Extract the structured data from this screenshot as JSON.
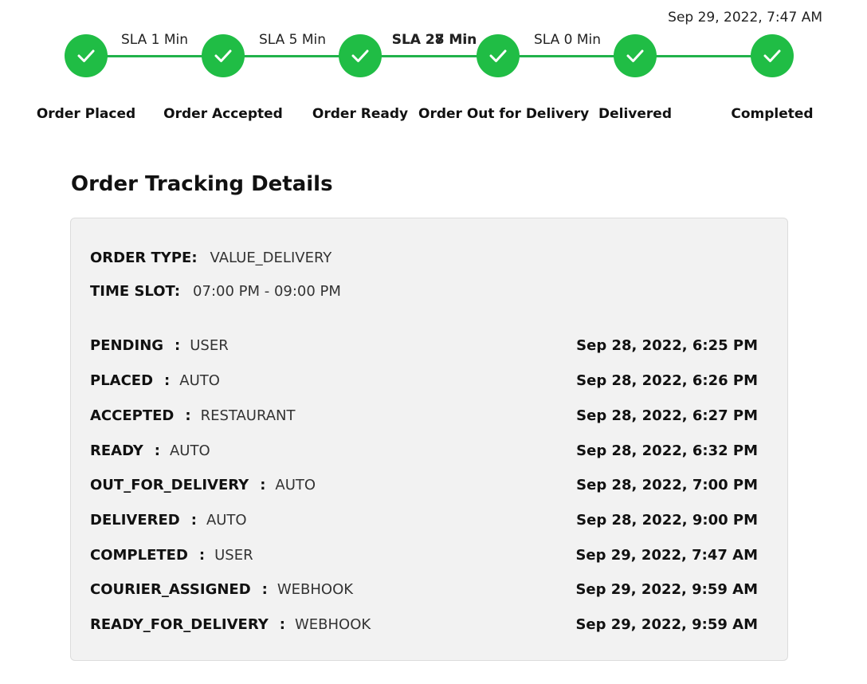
{
  "progress": {
    "completed_time": "Sep 29, 2022, 7:47 AM",
    "steps": [
      {
        "label": "Order Placed",
        "done": true
      },
      {
        "label": "Order Accepted",
        "done": true
      },
      {
        "label": "Order Ready",
        "done": true
      },
      {
        "label": "Order Out for Delivery",
        "done": true
      },
      {
        "label": "Delivered",
        "done": true
      },
      {
        "label": "Completed",
        "done": true
      }
    ],
    "sla": [
      "SLA 1 Min",
      "SLA 5 Min",
      "SLA 28 Min",
      "SLA 0 Min"
    ],
    "sla_overlap_alt": "SLA 27 Min",
    "accent_color": "#20bd45"
  },
  "details": {
    "title": "Order Tracking Details",
    "order_type_label": "ORDER TYPE:",
    "order_type_value": "VALUE_DELIVERY",
    "time_slot_label": "TIME SLOT:",
    "time_slot_value": "07:00 PM - 09:00 PM",
    "separator": ":",
    "history": [
      {
        "status": "PENDING",
        "actor": "USER",
        "time": "Sep 28, 2022, 6:25 PM"
      },
      {
        "status": "PLACED",
        "actor": "AUTO",
        "time": "Sep 28, 2022, 6:26 PM"
      },
      {
        "status": "ACCEPTED",
        "actor": "RESTAURANT",
        "time": "Sep 28, 2022, 6:27 PM"
      },
      {
        "status": "READY",
        "actor": "AUTO",
        "time": "Sep 28, 2022, 6:32 PM"
      },
      {
        "status": "OUT_FOR_DELIVERY",
        "actor": "AUTO",
        "time": "Sep 28, 2022, 7:00 PM"
      },
      {
        "status": "DELIVERED",
        "actor": "AUTO",
        "time": "Sep 28, 2022, 9:00 PM"
      },
      {
        "status": "COMPLETED",
        "actor": "USER",
        "time": "Sep 29, 2022, 7:47 AM"
      },
      {
        "status": "COURIER_ASSIGNED",
        "actor": "WEBHOOK",
        "time": "Sep 29, 2022, 9:59 AM"
      },
      {
        "status": "READY_FOR_DELIVERY",
        "actor": "WEBHOOK",
        "time": "Sep 29, 2022, 9:59 AM"
      }
    ]
  }
}
